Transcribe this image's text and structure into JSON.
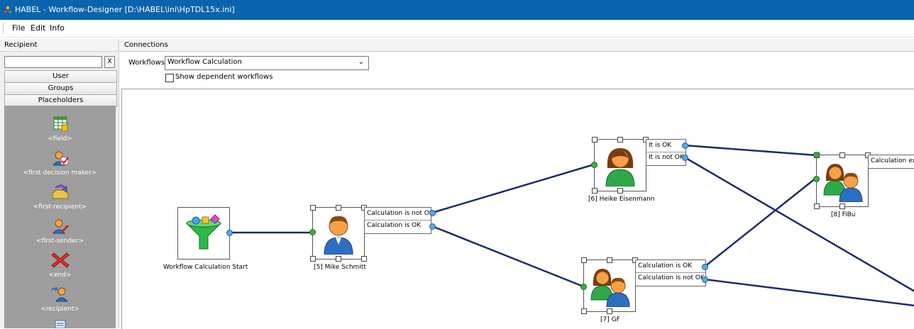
{
  "window": {
    "title": "HABEL - Workflow-Designer [D:\\HABEL\\ini\\HpTDL15x.ini]",
    "icon": "habel-app-icon"
  },
  "menu": {
    "items": [
      {
        "label": "File"
      },
      {
        "label": "Edit"
      },
      {
        "label": "Info"
      }
    ]
  },
  "recipient_pane": {
    "header": "Recipient",
    "search_value": "",
    "clear_label": "X",
    "categories": [
      {
        "label": "User"
      },
      {
        "label": "Groups"
      },
      {
        "label": "Placeholders"
      }
    ],
    "placeholders": [
      {
        "label": "<field>",
        "icon": "table-field-icon"
      },
      {
        "label": "<first decision maker>",
        "icon": "user-checkmark-icon"
      },
      {
        "label": "<first-recipient>",
        "icon": "inbox-arrow-icon"
      },
      {
        "label": "<first-sender>",
        "icon": "user-pen-icon"
      },
      {
        "label": "<end>",
        "icon": "red-x-icon"
      },
      {
        "label": "<recipient>",
        "icon": "user-arrow-icon"
      }
    ]
  },
  "connections_pane": {
    "header": "Connections",
    "workflows_label": "Workflows",
    "workflow_selected": "Workflow Calculation",
    "show_dependent_label": "Show dependent workflows",
    "show_dependent_checked": false
  },
  "diagram": {
    "nodes": [
      {
        "id": "start",
        "label": "Workflow Calculation Start",
        "icon": "funnel-icon"
      },
      {
        "id": "n5",
        "label": "[5] Mike Schmitt",
        "icon": "user-male-icon",
        "outcomes": [
          "Calculation is not OK",
          "Calculation is OK"
        ]
      },
      {
        "id": "n6",
        "label": "[6] Heike Eisenmann",
        "icon": "user-female-icon",
        "outcomes": [
          "It is OK",
          "It is not OK"
        ]
      },
      {
        "id": "n7",
        "label": "[7] GF",
        "icon": "user-group-icon",
        "outcomes": [
          "Calculation is OK",
          "Calculation is not OK"
        ]
      },
      {
        "id": "n8",
        "label": "[8] FiBu",
        "icon": "user-group-icon",
        "outcomes": [
          "Calculation exa"
        ]
      }
    ],
    "connections": [
      {
        "from": "start",
        "to": "n5"
      },
      {
        "from": "n5.Calculation is not OK",
        "to": "n6"
      },
      {
        "from": "n5.Calculation is OK",
        "to": "n7"
      },
      {
        "from": "n6.It is OK",
        "to": "n8"
      },
      {
        "from": "n6.It is not OK",
        "to": "offscreen"
      },
      {
        "from": "n7.Calculation is OK",
        "to": "n8"
      },
      {
        "from": "n7.Calculation is not OK",
        "to": "offscreen"
      }
    ],
    "colors": {
      "connector": "#1d2a6b",
      "in_port": "#3fae3f",
      "out_port": "#5aa8e8"
    }
  }
}
